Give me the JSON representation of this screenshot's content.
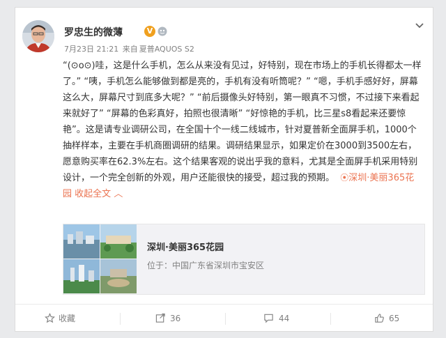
{
  "author": {
    "name": "罗忠生的微薄",
    "verified_badge": "V"
  },
  "meta": {
    "date": "7月23日 21:21",
    "source_prefix": "来自",
    "source_device": "夏普AQUOS S2"
  },
  "post": {
    "text": "“(⊙o⊙)哇，这是什么手机，怎么从来没有见过，好特别，现在市场上的手机长得都太一样了。”  “咦，手机怎么能够做到都是亮的，手机有没有听筒呢？”  “嗯，手机手感好好，屏幕这么大，屏幕尺寸到底多大呢？”  “前后摄像头好特别，第一眼真不习惯，不过接下来看起来就好了”  “屏幕的色彩真好，拍照也很清晰”  “好惊艳的手机，比三星s8看起来还要惊艳”。这是请专业调研公司，在全国十个一线二线城市，针对夏普新全面屏手机，1000个抽样样本，主要在手机商圈调研的结果。调研结果显示，如果定价在3000到3500左右，愿意购买率在62.3%左右。这个结果客观的说出乎我的意料，尤其是全面屏手机采用特别设计，一个完全创新的外观，用户还能很快的接受，超过我的预期。",
    "location_link": "深圳·美丽365花园",
    "collapse_label": "收起全文",
    "collapse_arrow": "︿"
  },
  "location_card": {
    "title": "深圳·美丽365花园",
    "address": "位于：中国广东省深圳市宝安区"
  },
  "actions": {
    "favorite_label": "收藏",
    "repost_count": "36",
    "comment_count": "44",
    "like_count": "65"
  },
  "colors": {
    "accent": "#eb7350",
    "badge": "#f0a01e",
    "muted": "#808080"
  },
  "icons": {
    "more": "chevron-down-icon",
    "location": "location-pin-icon",
    "favorite": "star-icon",
    "repost": "repost-icon",
    "comment": "comment-icon",
    "like": "thumbs-up-icon"
  }
}
